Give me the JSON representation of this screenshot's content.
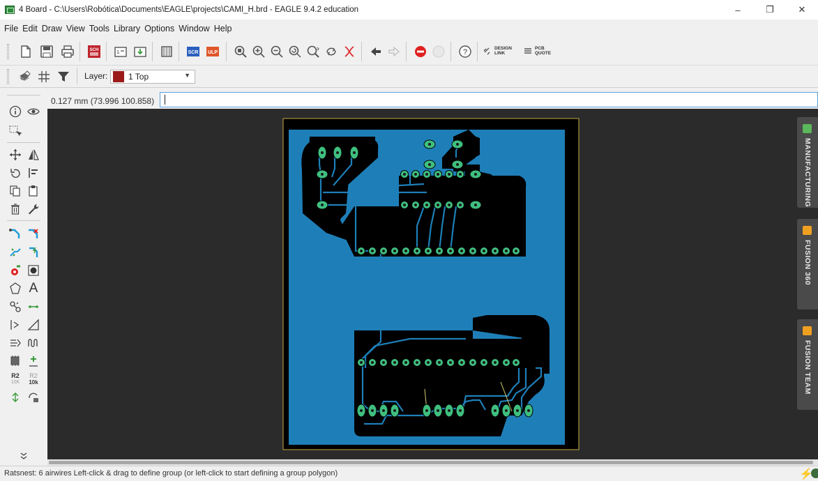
{
  "window": {
    "title": "4 Board - C:\\Users\\Robótica\\Documents\\EAGLE\\projects\\CAMI_H.brd - EAGLE 9.4.2 education",
    "minimize": "–",
    "maximize": "❐",
    "close": "✕"
  },
  "menu": [
    "File",
    "Edit",
    "Draw",
    "View",
    "Tools",
    "Library",
    "Options",
    "Window",
    "Help"
  ],
  "toolbar": {
    "sch_label": "SCH",
    "scr_label": "SCR",
    "ulp_label": "ULP",
    "help_label": "?",
    "design_link": "DESIGN\nLINK",
    "pcb_quote": "PCB\nQUOTE"
  },
  "layer": {
    "label": "Layer:",
    "selected": "1 Top",
    "color": "#9b1b1b"
  },
  "command": {
    "coords": "0.127 mm (73.996 100.858)",
    "value": ""
  },
  "left_tools": {
    "text_tool": "A",
    "r2_label": "R2",
    "r2_sub": "10K",
    "r2b_label": "R2",
    "r2b_sub": "10k"
  },
  "right_tabs": [
    {
      "label": "MANUFACTURING",
      "icon_color": "#5cb85c"
    },
    {
      "label": "FUSION 360",
      "icon_color": "#f0a020"
    },
    {
      "label": "FUSION TEAM",
      "icon_color": "#f0a020"
    }
  ],
  "status": {
    "text": "Ratsnest: 6 airwires Left-click & drag to define group (or left-click to start defining a group polygon)"
  },
  "colors": {
    "board_fill": "#1e7fb8",
    "copper_pour": "#000000",
    "trace": "#1e7fb8",
    "pad": "#3fbf7f",
    "board_outline": "#c8a83c",
    "canvas_bg": "#2b2b2b"
  }
}
